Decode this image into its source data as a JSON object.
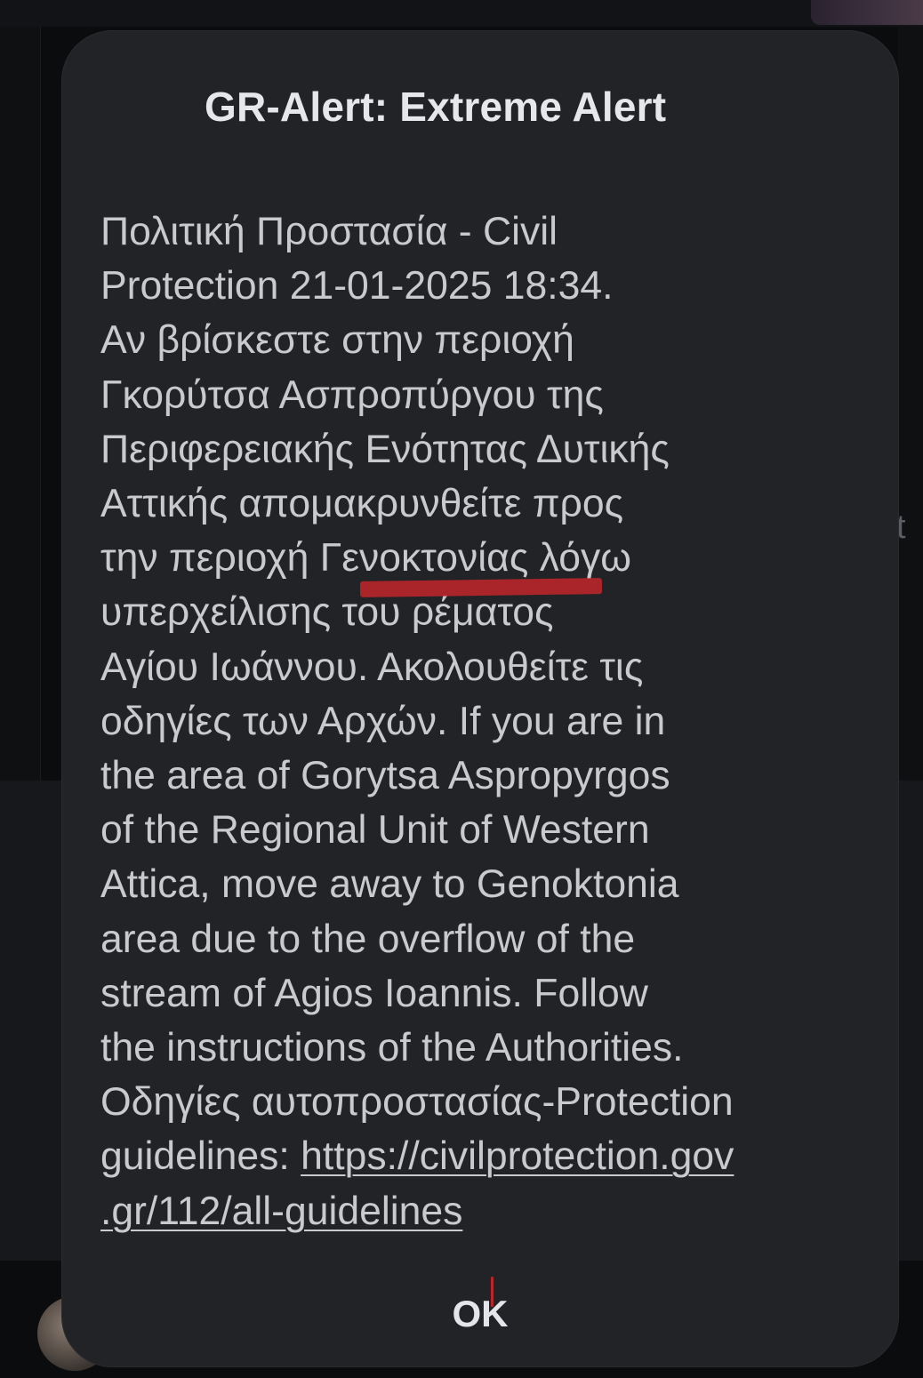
{
  "background": {
    "peek_text": "t"
  },
  "alert": {
    "title": "GR-Alert: Extreme Alert",
    "body_lines": [
      "Πολιτική Προστασία - Civil",
      "Protection 21-01-2025 18:34.",
      "Αν βρίσκεστε στην περιοχή",
      "Γκορύτσα Ασπροπύργου της",
      "Περιφερειακής Ενότητας Δυτικής",
      "Αττικής απομακρυνθείτε προς",
      "την περιοχή Γενοκτονίας  λόγω",
      "υπερχείλισης του ρέματος",
      "Αγίου Ιωάννου. Ακολουθείτε τις",
      "οδηγίες των Αρχών. If you are in",
      "the area of Gorytsa Aspropyrgos",
      "of the Regional Unit of Western",
      "Attica, move away to Genoktonia",
      "area due to the overflow of the",
      "stream of Agios Ioannis. Follow",
      "the instructions of the Authorities.",
      "Οδηγίες αυτοπροστασίας-Protection"
    ],
    "guidelines_prefix": "guidelines: ",
    "link_part1": "https://civilprotection.gov",
    "link_part2": ".gr/112/all-guidelines",
    "ok_label": "OK"
  },
  "colors": {
    "dialog_bg": "#222326",
    "text": "#c9cacd",
    "title": "#e6e7ea",
    "highlight_mark": "#b8262b"
  }
}
